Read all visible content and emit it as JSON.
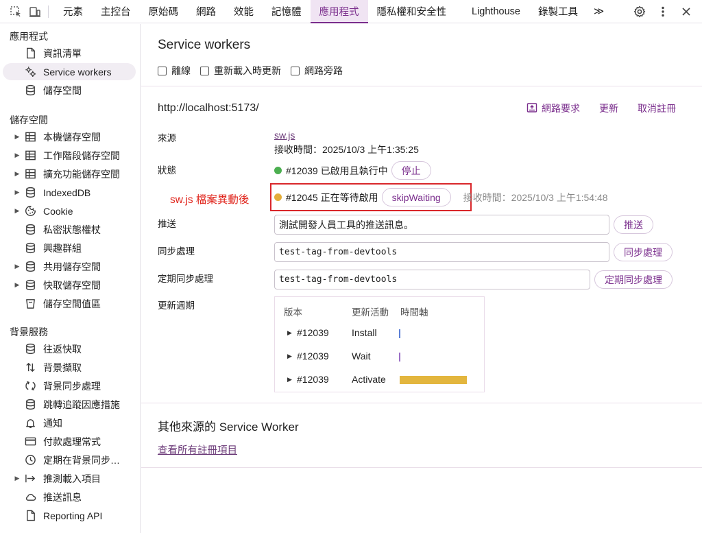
{
  "toolbar": {
    "tabs": [
      "元素",
      "主控台",
      "原始碼",
      "網路",
      "效能",
      "記憶體",
      "應用程式",
      "隱私權和安全性",
      "Lighthouse",
      "錄製工具"
    ],
    "more": "≫"
  },
  "sidebar": {
    "app_section": "應用程式",
    "app_items": [
      "資訊清單",
      "Service workers",
      "儲存空間"
    ],
    "storage_section": "儲存空間",
    "storage_items": [
      "本機儲存空間",
      "工作階段儲存空間",
      "擴充功能儲存空間",
      "IndexedDB",
      "Cookie",
      "私密狀態權杖",
      "興趣群組",
      "共用儲存空間",
      "快取儲存空間",
      "儲存空間值區"
    ],
    "bg_section": "背景服務",
    "bg_items": [
      "往返快取",
      "背景擷取",
      "背景同步處理",
      "跳轉追蹤因應措施",
      "通知",
      "付款處理常式",
      "定期在背景同步…",
      "推測載入項目",
      "推送訊息",
      "Reporting API"
    ]
  },
  "main": {
    "title": "Service workers",
    "options": [
      "離線",
      "重新載入時更新",
      "網路旁路"
    ],
    "origin": "http://localhost:5173/",
    "actions": [
      "網路要求",
      "更新",
      "取消註冊"
    ],
    "labels": {
      "source": "來源",
      "status": "狀態",
      "push": "推送",
      "sync": "同步處理",
      "periodic_sync": "定期同步處理",
      "update_cycle": "更新週期"
    },
    "source_file": "sw.js",
    "received_time": "接收時間：2025/10/3 上午1:35:25",
    "status_active": "#12039 已啟用且執行中",
    "stop_button": "停止",
    "status_waiting": "#12045 正在等待啟用",
    "skip_waiting_button": "skipWaiting",
    "waiting_received": "接收時間：2025/10/3 上午1:54:48",
    "annotation": "sw.js 檔案異動後",
    "push_value": "測試開發人員工具的推送訊息。",
    "push_button": "推送",
    "sync_value": "test-tag-from-devtools",
    "sync_button": "同步處理",
    "periodic_value": "test-tag-from-devtools",
    "periodic_button": "定期同步處理",
    "cycle": {
      "headers": [
        "版本",
        "更新活動",
        "時間軸"
      ],
      "rows": [
        {
          "version": "#12039",
          "activity": "Install"
        },
        {
          "version": "#12039",
          "activity": "Wait"
        },
        {
          "version": "#12039",
          "activity": "Activate"
        }
      ]
    },
    "other_title": "其他來源的 Service Worker",
    "see_all": "查看所有註冊項目"
  },
  "colors": {
    "accent": "#7a2d8c",
    "active_dot": "#4caf50",
    "waiting_dot": "#e3ad3a",
    "timeline_bar": "#e3b63e",
    "annotation_red": "#d9262a"
  }
}
